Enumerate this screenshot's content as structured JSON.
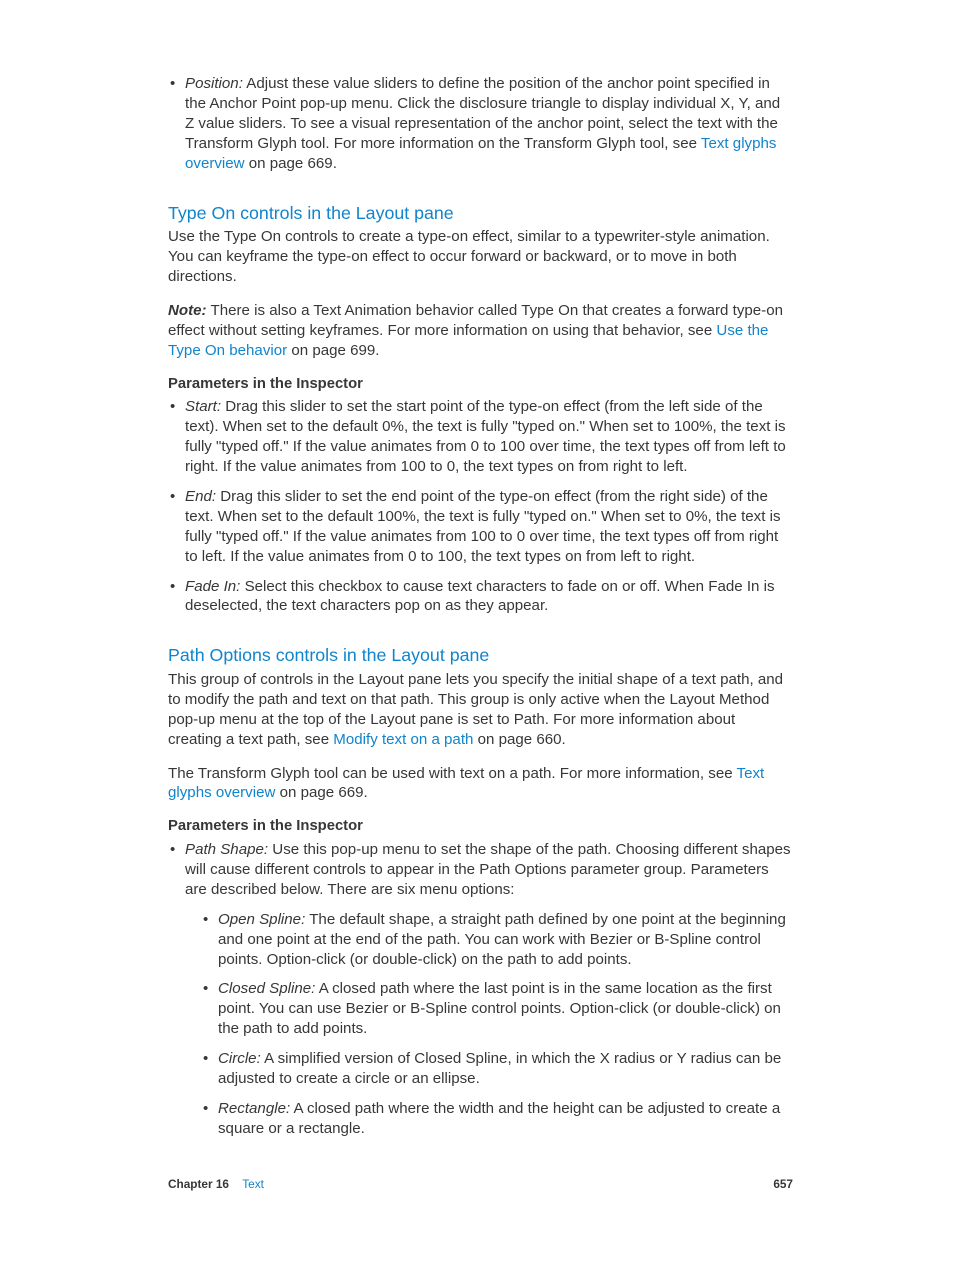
{
  "top_bullet": {
    "label": "Position:",
    "text1": " Adjust these value sliders to define the position of the anchor point specified in the Anchor Point pop-up menu. Click the disclosure triangle to display individual X, Y, and Z value sliders. To see a visual representation of the anchor point, select the text with the Transform Glyph tool. For more information on the Transform Glyph tool, see ",
    "link": "Text glyphs overview",
    "text2": " on page 669."
  },
  "type_on": {
    "heading": "Type On controls in the Layout pane",
    "intro": "Use the Type On controls to create a type-on effect, similar to a typewriter-style animation. You can keyframe the type-on effect to occur forward or backward, or to move in both directions.",
    "note_label": "Note:",
    "note1": "  There is also a Text Animation behavior called Type On that creates a forward type-on effect without setting keyframes. For more information on using that behavior, see ",
    "note_link": "Use the Type On behavior",
    "note2": " on page 699.",
    "param_head": "Parameters in the Inspector",
    "items": [
      {
        "label": "Start:",
        "text": " Drag this slider to set the start point of the type-on effect (from the left side of the text). When set to the default 0%, the text is fully \"typed on.\" When set to 100%, the text is fully \"typed off.\" If the value animates from 0 to 100 over time, the text types off from left to right. If the value animates from 100 to 0, the text types on from right to left."
      },
      {
        "label": "End:",
        "text": " Drag this slider to set the end point of the type-on effect (from the right side) of the text. When set to the default 100%, the text is fully \"typed on.\" When set to 0%, the text is fully \"typed off.\" If the value animates from 100 to 0 over time, the text types off from right to left. If the value animates from 0 to 100, the text types on from left to right."
      },
      {
        "label": "Fade In:",
        "text": " Select this checkbox to cause text characters to fade on or off. When Fade In is deselected, the text characters pop on as they appear."
      }
    ]
  },
  "path_options": {
    "heading": "Path Options controls in the Layout pane",
    "intro1": "This group of controls in the Layout pane lets you specify the initial shape of a text path, and to modify the path and text on that path. This group is only active when the Layout Method pop-up menu at the top of the Layout pane is set to Path. For more information about creating a text path, see ",
    "intro1_link": "Modify text on a path",
    "intro1_after": " on page 660.",
    "intro2_before": "The Transform Glyph tool can be used with text on a path. For more information, see ",
    "intro2_link": "Text glyphs overview",
    "intro2_after": " on page 669.",
    "param_head": "Parameters in the Inspector",
    "shape_label": "Path Shape:",
    "shape_text": " Use this pop-up menu to set the shape of the path. Choosing different shapes will cause different controls to appear in the Path Options parameter group. Parameters are described below. There are six menu options:",
    "shapes": [
      {
        "label": "Open Spline:",
        "text": " The default shape, a straight path defined by one point at the beginning and one point at the end of the path. You can work with Bezier or B-Spline control points. Option-click (or double-click) on the path to add points."
      },
      {
        "label": "Closed Spline:",
        "text": " A closed path where the last point is in the same location as the first point. You can use Bezier or B-Spline control points. Option-click (or double-click) on the path to add points."
      },
      {
        "label": "Circle:",
        "text": " A simplified version of Closed Spline, in which the X radius or Y radius can be adjusted to create a circle or an ellipse."
      },
      {
        "label": "Rectangle:",
        "text": " A closed path where the width and the height can be adjusted to create a square or a rectangle."
      }
    ]
  },
  "footer": {
    "chapter": "Chapter 16",
    "section": "Text",
    "page": "657"
  }
}
